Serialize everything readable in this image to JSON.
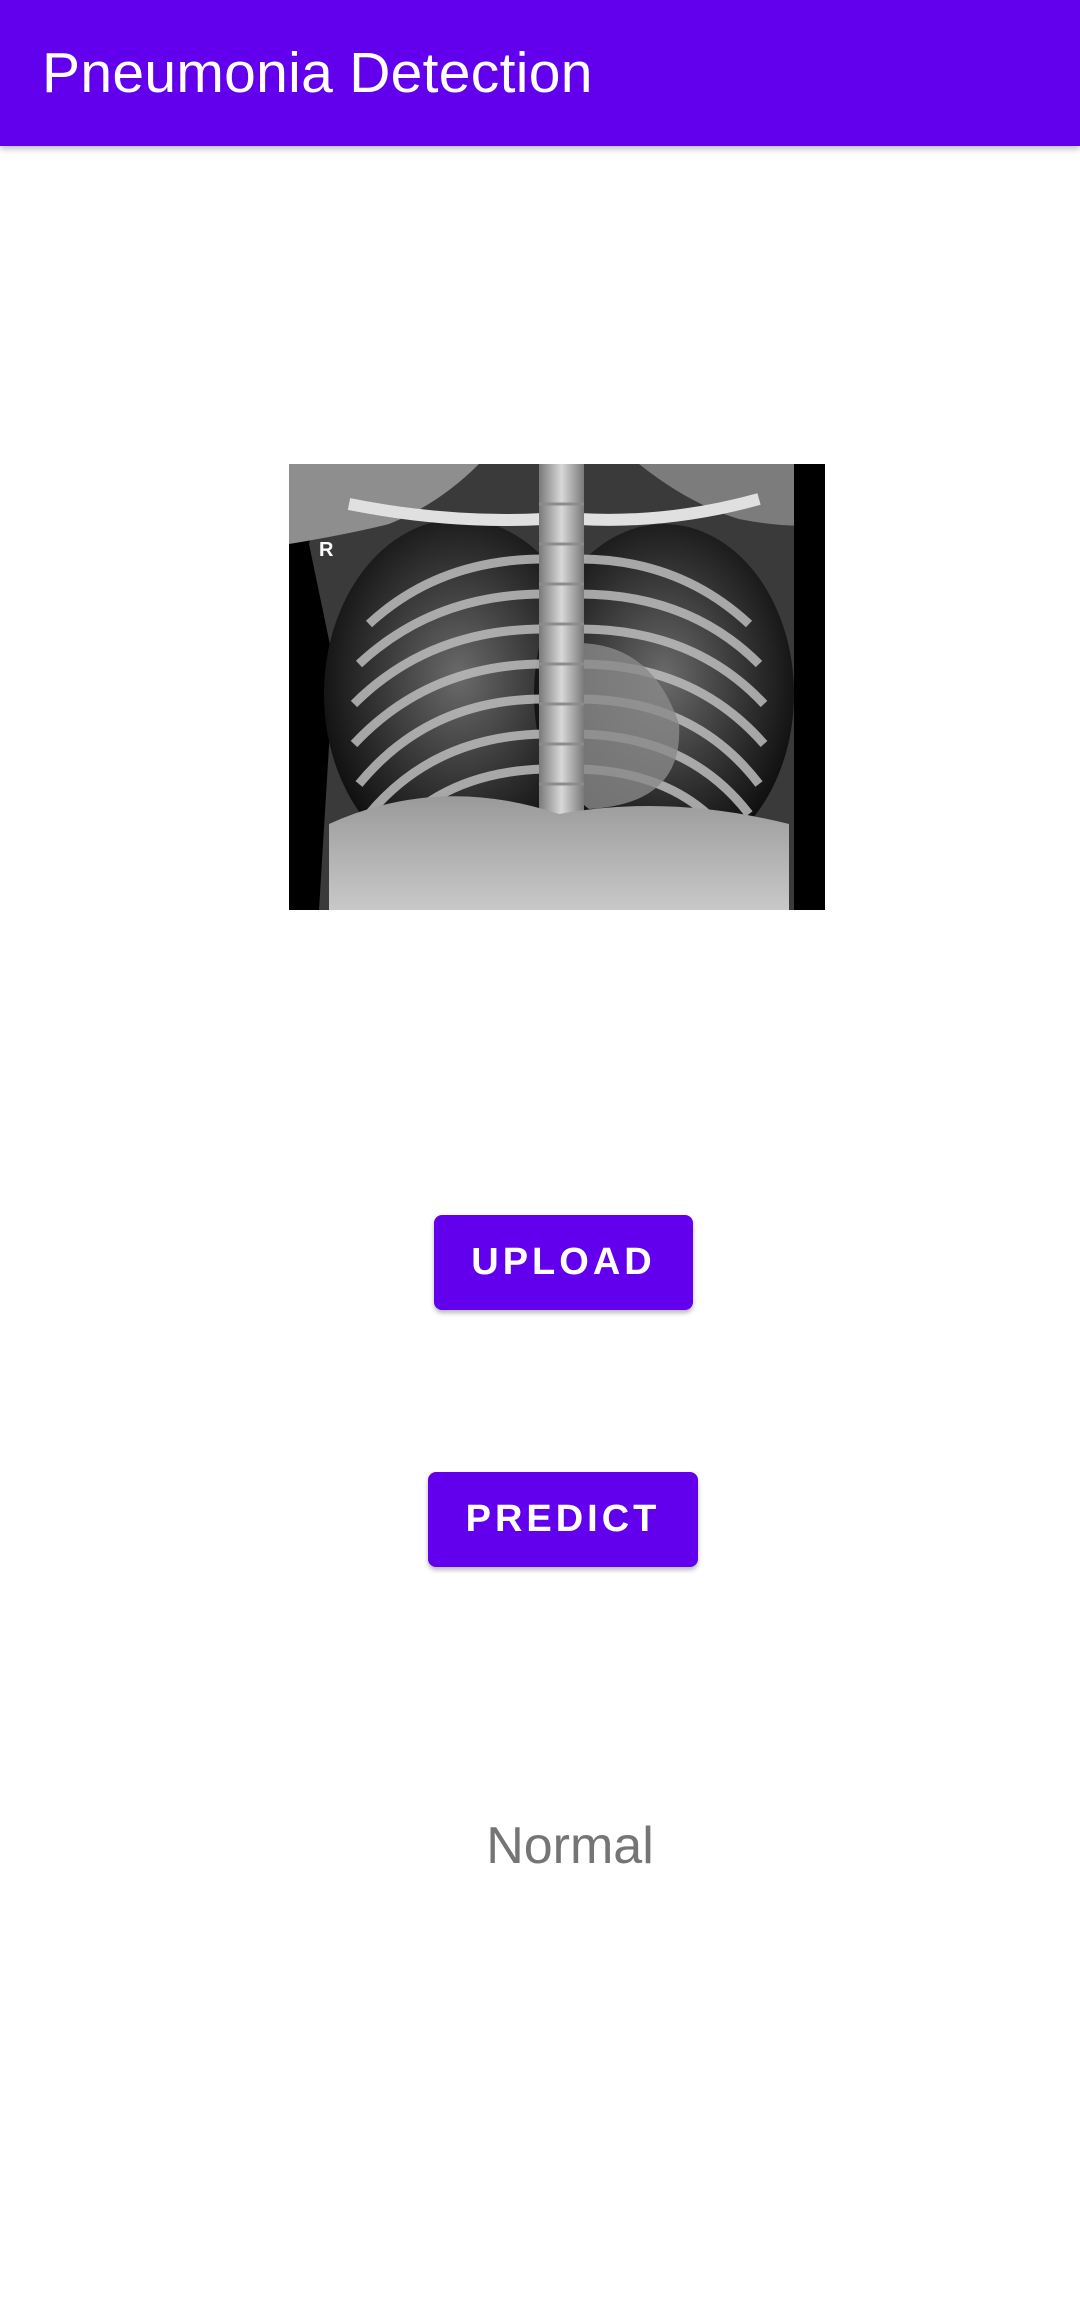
{
  "app_bar": {
    "title": "Pneumonia Detection",
    "color": "#6200ee"
  },
  "image": {
    "marker_letter": "R"
  },
  "buttons": {
    "upload_label": "UPLOAD",
    "predict_label": "PREDICT"
  },
  "result": {
    "text": "Normal",
    "color": "#757575"
  }
}
